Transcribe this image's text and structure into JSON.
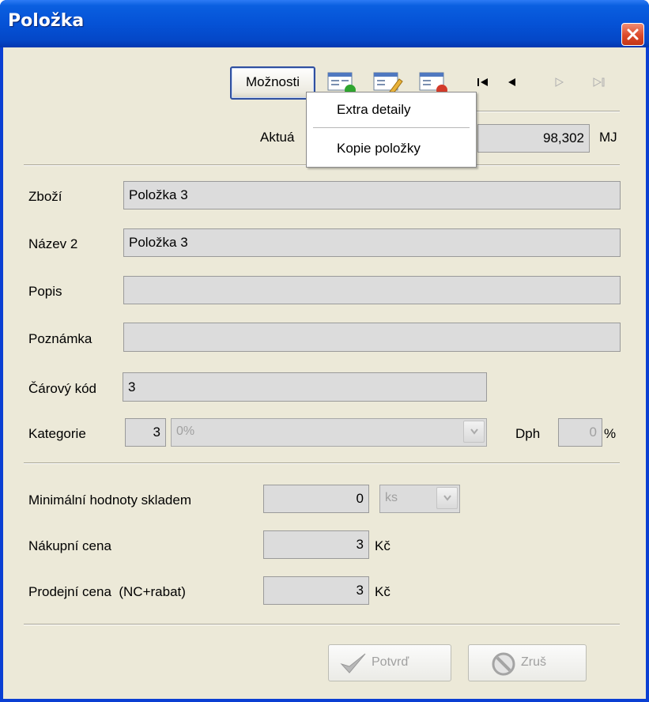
{
  "window": {
    "title": "Položka"
  },
  "toolbar": {
    "options_label": "Možnosti",
    "icons": [
      "record-add-icon",
      "record-edit-icon",
      "record-delete-icon"
    ],
    "nav": [
      "first-record-icon",
      "previous-record-icon",
      "next-record-icon",
      "last-record-icon"
    ]
  },
  "menu": {
    "items": [
      {
        "label": "Extra detaily"
      },
      {
        "label": "Kopie položky"
      }
    ]
  },
  "stock": {
    "label_visible": "Aktuá",
    "value": "98,302",
    "unit": "MJ"
  },
  "form": {
    "zbozi": {
      "label": "Zboží",
      "value": "Položka 3"
    },
    "nazev2": {
      "label": "Název 2",
      "value": "Položka 3"
    },
    "popis": {
      "label": "Popis",
      "value": ""
    },
    "poznamka": {
      "label": "Poznámka",
      "value": ""
    },
    "carovy_kod": {
      "label": "Čárový kód",
      "value": "3"
    },
    "kategorie": {
      "label": "Kategorie",
      "number": "3",
      "selected": "0%"
    },
    "dph": {
      "label": "Dph",
      "value": "0",
      "unit": "%"
    }
  },
  "limits": {
    "min_stock": {
      "label": "Minimální hodnoty skladem",
      "value": "0",
      "unit_selected": "ks"
    },
    "purchase_price": {
      "label": "Nákupní cena",
      "value": "3",
      "currency": "Kč"
    },
    "sale_price": {
      "label": "Prodejní cena  (NC+rabat)",
      "value": "3",
      "currency": "Kč"
    }
  },
  "buttons": {
    "confirm_label": "Potvrď",
    "cancel_label": "Zruš"
  },
  "colors": {
    "titlebar": "#0552d6",
    "window_bg": "#ece9d8",
    "field_bg": "#dcdcdc",
    "close_button": "#dc4a2a",
    "add_badge": "#2fa52f",
    "delete_badge": "#d23a2a"
  }
}
